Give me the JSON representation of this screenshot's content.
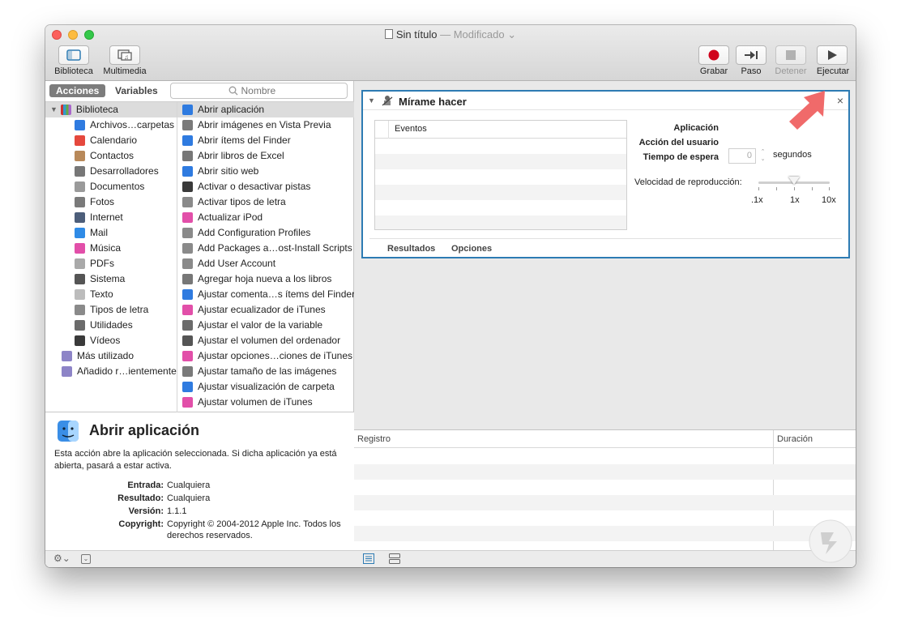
{
  "window": {
    "title": "Sin título",
    "modified": "— Modificado"
  },
  "toolbar": {
    "library_label": "Biblioteca",
    "media_label": "Multimedia",
    "record_label": "Grabar",
    "step_label": "Paso",
    "stop_label": "Detener",
    "run_label": "Ejecutar"
  },
  "sidebar": {
    "tab_actions": "Acciones",
    "tab_variables": "Variables",
    "search_placeholder": "Nombre",
    "library_root": "Biblioteca",
    "library_items": [
      {
        "label": "Archivos…carpetas",
        "icon": "finder-icon",
        "color": "#2f7be0"
      },
      {
        "label": "Calendario",
        "icon": "calendar-icon",
        "color": "#e5483d"
      },
      {
        "label": "Contactos",
        "icon": "contacts-icon",
        "color": "#b8895a"
      },
      {
        "label": "Desarrolladores",
        "icon": "tools-icon",
        "color": "#777777"
      },
      {
        "label": "Documentos",
        "icon": "document-icon",
        "color": "#9a9a9a"
      },
      {
        "label": "Fotos",
        "icon": "photos-icon",
        "color": "#7a7a7a"
      },
      {
        "label": "Internet",
        "icon": "globe-icon",
        "color": "#4d5e7a"
      },
      {
        "label": "Mail",
        "icon": "mail-icon",
        "color": "#2f8be6"
      },
      {
        "label": "Música",
        "icon": "music-icon",
        "color": "#e24fa9"
      },
      {
        "label": "PDFs",
        "icon": "pdf-icon",
        "color": "#a9a9a9"
      },
      {
        "label": "Sistema",
        "icon": "system-icon",
        "color": "#555555"
      },
      {
        "label": "Texto",
        "icon": "text-icon",
        "color": "#bcbcbc"
      },
      {
        "label": "Tipos de letra",
        "icon": "font-icon",
        "color": "#8a8a8a"
      },
      {
        "label": "Utilidades",
        "icon": "utilities-icon",
        "color": "#6b6b6b"
      },
      {
        "label": "Vídeos",
        "icon": "video-icon",
        "color": "#3a3a3a"
      }
    ],
    "smart_groups": [
      {
        "label": "Más utilizado",
        "icon": "folder-icon",
        "color": "#8d84c7"
      },
      {
        "label": "Añadido r…ientemente",
        "icon": "folder-icon",
        "color": "#8d84c7"
      }
    ],
    "actions": [
      {
        "label": "Abrir aplicación",
        "icon": "finder-icon",
        "color": "#2f7be0"
      },
      {
        "label": "Abrir imágenes en Vista Previa",
        "icon": "preview-icon",
        "color": "#7a7a7a"
      },
      {
        "label": "Abrir ítems del Finder",
        "icon": "finder-icon",
        "color": "#2f7be0"
      },
      {
        "label": "Abrir libros de Excel",
        "icon": "tools-icon",
        "color": "#777777"
      },
      {
        "label": "Abrir sitio web",
        "icon": "safari-icon",
        "color": "#2f7be0"
      },
      {
        "label": "Activar o desactivar pistas",
        "icon": "quicktime-icon",
        "color": "#3a3a3a"
      },
      {
        "label": "Activar tipos de letra",
        "icon": "font-icon",
        "color": "#8a8a8a"
      },
      {
        "label": "Actualizar iPod",
        "icon": "itunes-icon",
        "color": "#e24fa9"
      },
      {
        "label": "Add Configuration Profiles",
        "icon": "automator-icon",
        "color": "#8a8a8a"
      },
      {
        "label": "Add Packages a…ost-Install Scripts",
        "icon": "automator-icon",
        "color": "#8a8a8a"
      },
      {
        "label": "Add User Account",
        "icon": "automator-icon",
        "color": "#8a8a8a"
      },
      {
        "label": "Agregar hoja nueva a los libros",
        "icon": "tools-icon",
        "color": "#777777"
      },
      {
        "label": "Ajustar comenta…s ítems del Finder",
        "icon": "finder-icon",
        "color": "#2f7be0"
      },
      {
        "label": "Ajustar ecualizador de iTunes",
        "icon": "itunes-icon",
        "color": "#e24fa9"
      },
      {
        "label": "Ajustar el valor de la variable",
        "icon": "automator-icon",
        "color": "#6b6b6b"
      },
      {
        "label": "Ajustar el volumen del ordenador",
        "icon": "system-icon",
        "color": "#555555"
      },
      {
        "label": "Ajustar opciones…ciones de iTunes",
        "icon": "itunes-icon",
        "color": "#e24fa9"
      },
      {
        "label": "Ajustar tamaño de las imágenes",
        "icon": "preview-icon",
        "color": "#7a7a7a"
      },
      {
        "label": "Ajustar visualización de carpeta",
        "icon": "finder-icon",
        "color": "#2f7be0"
      },
      {
        "label": "Ajustar volumen de iTunes",
        "icon": "itunes-icon",
        "color": "#e24fa9"
      }
    ]
  },
  "description": {
    "title": "Abrir aplicación",
    "text": "Esta acción abre la aplicación seleccionada. Si dicha aplicación ya está abierta, pasará a estar activa.",
    "input_label": "Entrada:",
    "input_value": "Cualquiera",
    "result_label": "Resultado:",
    "result_value": "Cualquiera",
    "version_label": "Versión:",
    "version_value": "1.1.1",
    "copyright_label": "Copyright:",
    "copyright_value": "Copyright © 2004-2012 Apple Inc. Todos los derechos reservados."
  },
  "workflow": {
    "action_title": "Mírame hacer",
    "events_header": "Eventos",
    "app_label": "Aplicación",
    "user_action_label": "Acción del usuario",
    "wait_label": "Tiempo de espera",
    "wait_value": "0",
    "seconds_label": "segundos",
    "speed_label": "Velocidad de reproducción:",
    "speed_value": 0.5,
    "speed_ticks": [
      ".1x",
      "1x",
      "10x"
    ],
    "results_tab": "Resultados",
    "options_tab": "Opciones",
    "close_symbol": "×"
  },
  "log": {
    "col_log": "Registro",
    "col_duration": "Duración"
  },
  "colors": {
    "accent": "#2d7bb3",
    "record": "#d0021b",
    "callout": "#f06a6a"
  }
}
